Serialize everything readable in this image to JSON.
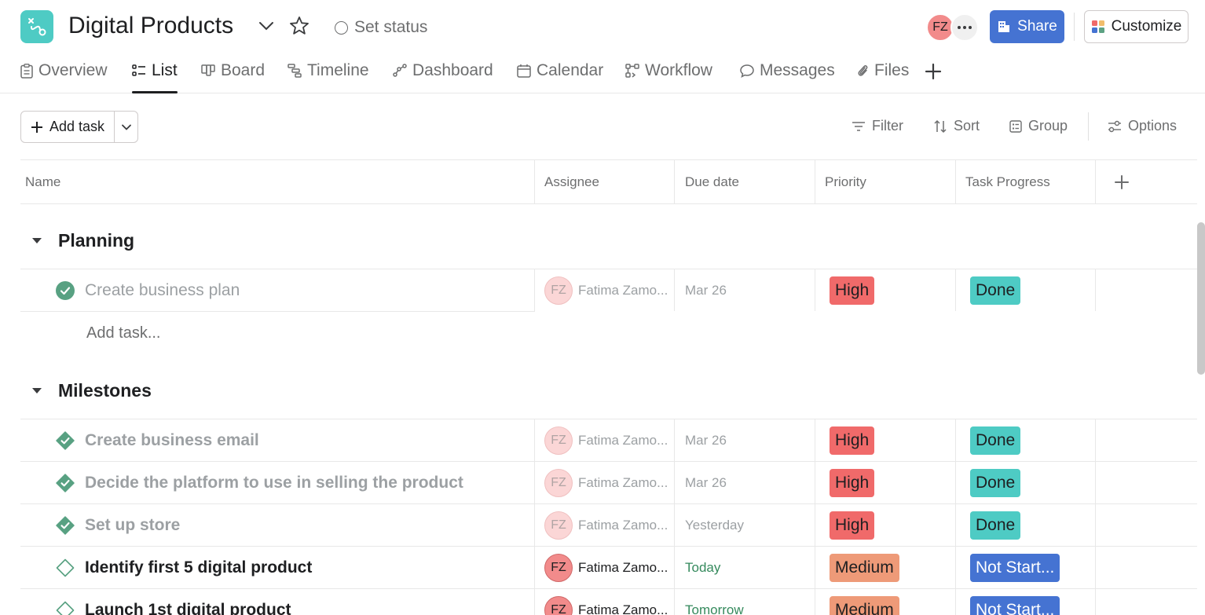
{
  "header": {
    "title": "Digital Products",
    "set_status": "Set status",
    "avatar_initials": "FZ",
    "share_label": "Share",
    "customize_label": "Customize"
  },
  "tabs": [
    {
      "label": "Overview",
      "icon": "clipboard-icon"
    },
    {
      "label": "List",
      "icon": "list-icon",
      "active": true
    },
    {
      "label": "Board",
      "icon": "board-icon"
    },
    {
      "label": "Timeline",
      "icon": "timeline-icon"
    },
    {
      "label": "Dashboard",
      "icon": "dashboard-icon"
    },
    {
      "label": "Calendar",
      "icon": "calendar-icon"
    },
    {
      "label": "Workflow",
      "icon": "workflow-icon"
    },
    {
      "label": "Messages",
      "icon": "message-icon"
    },
    {
      "label": "Files",
      "icon": "paperclip-icon"
    }
  ],
  "toolbar": {
    "add_task": "Add task",
    "filter": "Filter",
    "sort": "Sort",
    "group": "Group",
    "options": "Options"
  },
  "columns": [
    "Name",
    "Assignee",
    "Due date",
    "Priority",
    "Task Progress"
  ],
  "sections": [
    {
      "title": "Planning",
      "add_task_placeholder": "Add task...",
      "tasks": [
        {
          "name": "Create business plan",
          "completed": true,
          "assignee": "Fatima Zamo...",
          "initials": "FZ",
          "due": "Mar 26",
          "priority": "High",
          "progress": "Done"
        }
      ]
    },
    {
      "title": "Milestones",
      "tasks": [
        {
          "name": "Create business email",
          "completed": true,
          "assignee": "Fatima Zamo...",
          "initials": "FZ",
          "due": "Mar 26",
          "priority": "High",
          "progress": "Done"
        },
        {
          "name": "Decide the platform to use in selling the product",
          "completed": true,
          "assignee": "Fatima Zamo...",
          "initials": "FZ",
          "due": "Mar 26",
          "priority": "High",
          "progress": "Done"
        },
        {
          "name": "Set up store",
          "completed": true,
          "assignee": "Fatima Zamo...",
          "initials": "FZ",
          "due": "Yesterday",
          "priority": "High",
          "progress": "Done"
        },
        {
          "name": "Identify first 5 digital product",
          "completed": false,
          "assignee": "Fatima Zamo...",
          "initials": "FZ",
          "due": "Today",
          "priority": "Medium",
          "progress": "Not Start..."
        },
        {
          "name": "Launch 1st digital product",
          "completed": false,
          "assignee": "Fatima Zamo...",
          "initials": "FZ",
          "due": "Tomorrow",
          "priority": "Medium",
          "progress": "Not Start..."
        }
      ]
    }
  ],
  "colors": {
    "accent": "#4573d2",
    "high": "#f06a6a",
    "medium": "#ee9a78",
    "done": "#4ecbc4",
    "check_green": "#58a182",
    "due_green": "#358a5d"
  }
}
